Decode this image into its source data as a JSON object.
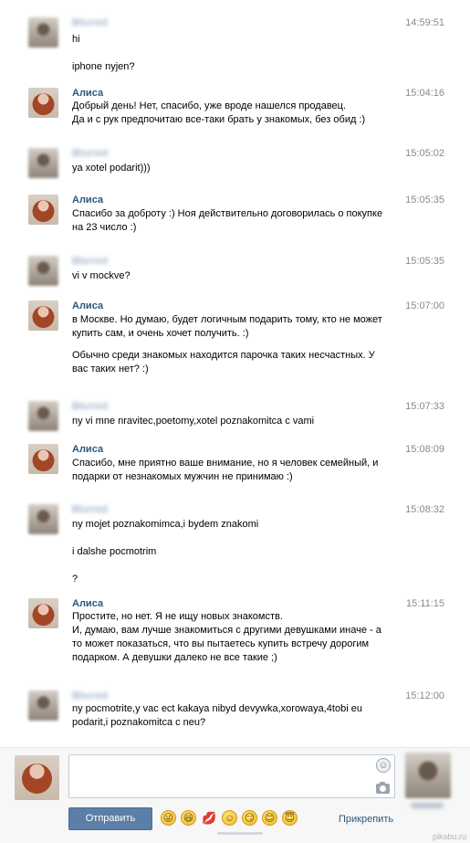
{
  "messages": [
    {
      "sender": "user",
      "name": "Blurred",
      "time": "14:59:51",
      "lines": [
        "hi",
        "iphone nyjen?"
      ]
    },
    {
      "sender": "alice",
      "name": "Алиса",
      "time": "15:04:16",
      "lines": [
        "Добрый день! Нет, спасибо, уже вроде нашелся продавец.",
        "Да и с рук предпочитаю все-таки брать у знакомых, без обид :)"
      ]
    },
    {
      "sender": "user",
      "name": "Blurred",
      "time": "15:05:02",
      "lines": [
        "ya xotel podarit)))"
      ]
    },
    {
      "sender": "alice",
      "name": "Алиса",
      "time": "15:05:35",
      "lines": [
        "Спасибо за доброту :) Ноя действительно договорилась о покупке",
        "на 23 число :)"
      ]
    },
    {
      "sender": "user",
      "name": "Blurred",
      "time": "15:05:35",
      "lines": [
        "vi v mockve?"
      ]
    },
    {
      "sender": "alice",
      "name": "Алиса",
      "time": "15:07:00",
      "lines": [
        "в Москве. Но думаю, будет логичным подарить тому, кто не может",
        "купить сам, и очень хочет получить. :)",
        "Обычно среди знакомых находится парочка таких несчастных. У",
        "вас таких нет? :)"
      ]
    },
    {
      "sender": "user",
      "name": "Blurred",
      "time": "15:07:33",
      "lines": [
        "ny vi mne nravitec,poetomy,xotel poznakomitca c vami"
      ]
    },
    {
      "sender": "alice",
      "name": "Алиса",
      "time": "15:08:09",
      "lines": [
        "Спасибо, мне приятно ваше внимание, но я человек семейный, и",
        "подарки от незнакомых мужчин не принимаю :)"
      ]
    },
    {
      "sender": "user",
      "name": "Blurred",
      "time": "15:08:32",
      "lines": [
        "ny mojet poznakomimca,i bydem znakomi",
        "i dalshe pocmotrim",
        "?"
      ]
    },
    {
      "sender": "alice",
      "name": "Алиса",
      "time": "15:11:15",
      "lines": [
        "Простите, но нет. Я не ищу новых знакомств.",
        "И, думаю, вам лучше знакомиться с другими девушками иначе - а",
        "то может показаться, что вы пытаетесь купить встречу дорогим",
        "подарком. А девушки далеко не все такие ;)"
      ]
    },
    {
      "sender": "user",
      "name": "Blurred",
      "time": "15:12:00",
      "lines": [
        "ny pocmotrite,y vac ect kakaya nibyd devywka,xorowaya,4tobi eu",
        "podarit,i poznakomitca c neu?"
      ]
    }
  ],
  "composer": {
    "send_label": "Отправить",
    "attach_label": "Прикрепить",
    "emojis": [
      "😜",
      "😆",
      "💋",
      "☺",
      "😏",
      "😊",
      "😇"
    ]
  },
  "watermark": "pikabu.ru"
}
